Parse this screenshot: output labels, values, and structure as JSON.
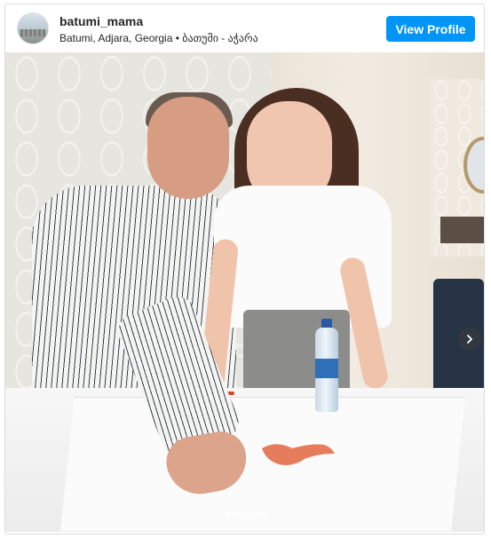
{
  "header": {
    "username": "batumi_mama",
    "location": "Batumi, Adjara, Georgia • ბათუმი - აჭარა",
    "view_profile_label": "View Profile"
  },
  "media": {
    "carousel_count": 5,
    "active_index": 0,
    "next_icon": "chevron-right-icon"
  },
  "colors": {
    "accent": "#0095f6",
    "handprint": "#e0653f"
  }
}
